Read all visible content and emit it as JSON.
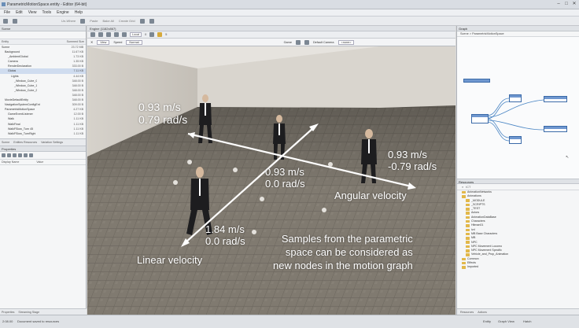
{
  "window": {
    "title": "ParametricMotionSpace.entity - Editor (64-bit)",
    "minimize": "–",
    "maximize": "□",
    "close": "✕"
  },
  "menu": [
    "File",
    "Edit",
    "View",
    "Tools",
    "Engine",
    "Help"
  ],
  "toolbar": {
    "items": [
      "Un-Where",
      "Paste",
      "Bake All",
      "Create Grid"
    ]
  },
  "scene_panel": {
    "title": "Scene",
    "col_name": "Entity",
    "col_size": "Summed Size",
    "rows": [
      {
        "name": "Scene",
        "size": "23.72 MB",
        "indent": 0
      },
      {
        "name": "Background",
        "size": "11.67 KB",
        "indent": 1
      },
      {
        "name": "_AmbientGlobal",
        "size": "1.73 KB",
        "indent": 2
      },
      {
        "name": "Camera",
        "size": "1.35 KB",
        "indent": 2
      },
      {
        "name": "RenderDeclaration",
        "size": "333.00 B",
        "indent": 2
      },
      {
        "name": "Global",
        "size": "7.11 KB",
        "indent": 2
      },
      {
        "name": "Lights",
        "size": "4.44 KB",
        "indent": 3
      },
      {
        "name": "_Window_Cube_0",
        "size": "348.00 B",
        "indent": 4
      },
      {
        "name": "_Window_Cube_1",
        "size": "348.00 B",
        "indent": 4
      },
      {
        "name": "_Window_Cube_2",
        "size": "348.00 B",
        "indent": 4
      },
      {
        "name": "",
        "size": "348.00 B",
        "indent": 4
      },
      {
        "name": "MovieDefaultEntity",
        "size": "348.00 B",
        "indent": 1
      },
      {
        "name": "NavigationSystemConfigEnt",
        "size": "309.00 B",
        "indent": 1
      },
      {
        "name": "ParametricMotionSpace",
        "size": "4.27 KB",
        "indent": 1
      },
      {
        "name": "GameEventListener",
        "size": "12.00 B",
        "indent": 2
      },
      {
        "name": "Walk",
        "size": "1.11 KB",
        "indent": 2
      },
      {
        "name": "WalkFinal",
        "size": "1.11 KB",
        "indent": 2
      },
      {
        "name": "WalkFSlow_Turn 45",
        "size": "1.11 KB",
        "indent": 2
      },
      {
        "name": "WalkFSlow_TurnRight",
        "size": "1.11 KB",
        "indent": 2
      }
    ],
    "selected_index": 5,
    "tabs": [
      "Scene",
      "Entities Resources",
      "Variation Settings"
    ]
  },
  "properties_panel": {
    "title": "Properties",
    "col_name": "Display Name",
    "col_value": "Value",
    "bottom_tabs": [
      "Properties",
      "Streaming Stage"
    ]
  },
  "viewport": {
    "title": "Engine (1182x867)",
    "tool_local": "Local",
    "tool_grid": "0",
    "tool_snap": "5",
    "view_button": "View",
    "speed_label": "Speed",
    "speed_value": "Normal",
    "game_label": "Game",
    "camera_label": "Default Camera",
    "camera_value": "<none>"
  },
  "overlay": {
    "label_top_left_1": "0.93 m/s",
    "label_top_left_2": "0.79 rad/s",
    "label_right_1": "0.93 m/s",
    "label_right_2": "-0.79 rad/s",
    "label_center_1": "0.93 m/s",
    "label_center_2": "0.0 rad/s",
    "label_bottom_1": "1.84 m/s",
    "label_bottom_2": "0.0 rad/s",
    "angular_axis": "Angular velocity",
    "linear_axis": "Linear velocity",
    "caption_1": "Samples from the parametric",
    "caption_2": "space can be considered as",
    "caption_3": "new nodes in the motion graph"
  },
  "graph_panel": {
    "title": "Graph",
    "breadcrumb": "Scene > ParametricMotionSpace"
  },
  "resources_panel": {
    "title": "Resources",
    "search": "ICT",
    "items": [
      {
        "name": "AnimationNetworks",
        "indent": 0
      },
      {
        "name": "Animations",
        "indent": 0
      },
      {
        "name": "_MODULE",
        "indent": 1
      },
      {
        "name": "_SCRIPTS",
        "indent": 1
      },
      {
        "name": "_TEST",
        "indent": 1
      },
      {
        "name": "Actors",
        "indent": 1
      },
      {
        "name": "AnimationDataBase",
        "indent": 1
      },
      {
        "name": "Characters",
        "indent": 1
      },
      {
        "name": "Hitman01",
        "indent": 1
      },
      {
        "name": "ivd",
        "indent": 1
      },
      {
        "name": "MB Base Characters",
        "indent": 1
      },
      {
        "name": "MB",
        "indent": 1
      },
      {
        "name": "NPC",
        "indent": 1
      },
      {
        "name": "NPC Movement Locomo",
        "indent": 1
      },
      {
        "name": "NPC Movement Specific",
        "indent": 1
      },
      {
        "name": "Vehicle_and_Prop_Animation",
        "indent": 1
      },
      {
        "name": "Common",
        "indent": 0
      },
      {
        "name": "Effects",
        "indent": 0
      },
      {
        "name": "Imported",
        "indent": 0
      }
    ],
    "bottom_tabs": [
      "Resources",
      "Actions"
    ]
  },
  "statusbar": {
    "left": "2:08.00",
    "message": "Document saved to resources",
    "right": [
      "Entity",
      "Graph View",
      "Hatch"
    ]
  },
  "colors": {
    "accent": "#3b6aa8",
    "floor": "#7d766c",
    "wall": "#cfcac2"
  }
}
